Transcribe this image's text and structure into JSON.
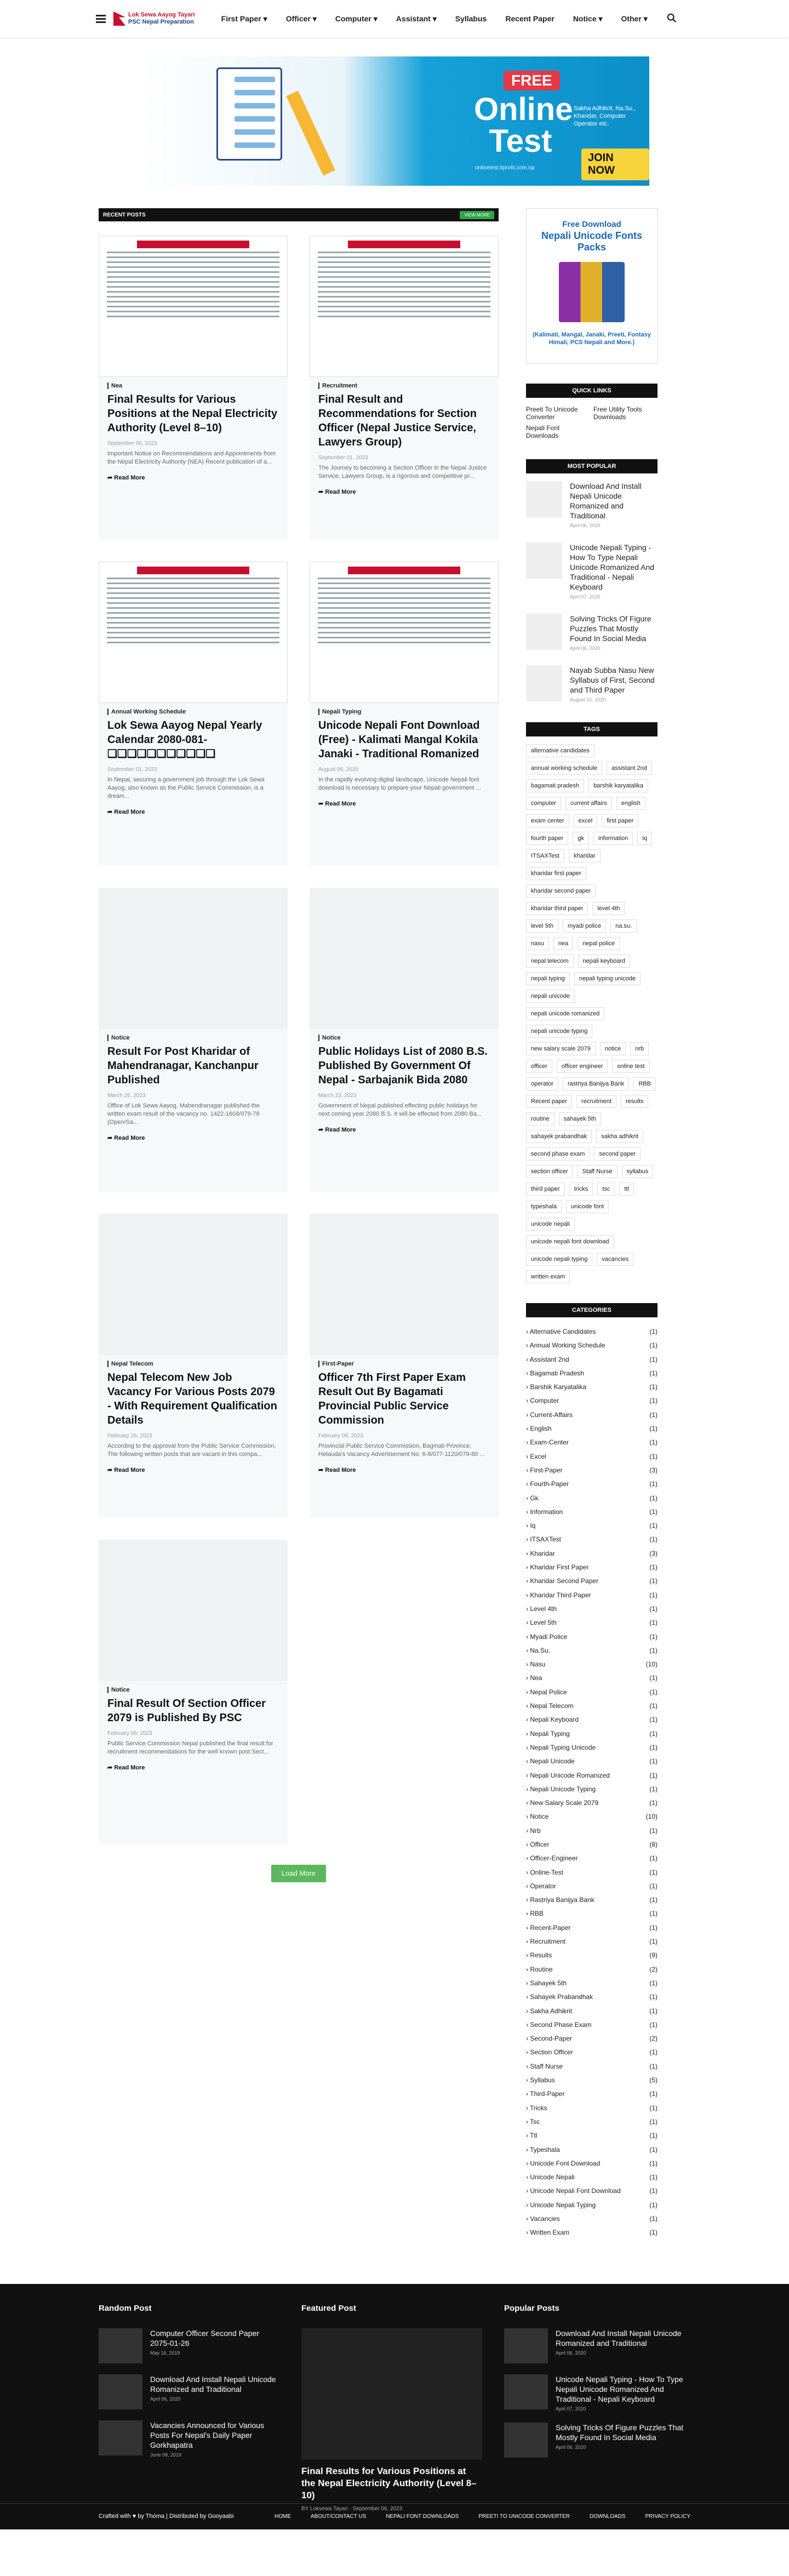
{
  "nav": {
    "logo_line1": "Lok Sewa Aayog Tayari",
    "logo_line2": "PSC Nepal Preparation",
    "menu": [
      "First Paper",
      "Officer",
      "Computer",
      "Assistant",
      "Syllabus",
      "Recent Paper",
      "Notice",
      "Other"
    ]
  },
  "banner": {
    "free": "FREE",
    "online": "Online",
    "test": "Test",
    "sub": "Sakha Adhikrit, Na.Su., Kharidar, Computer Operator etc.",
    "join": "JOIN NOW",
    "url": "onlinetest.itprofit.com.np"
  },
  "recent": {
    "title": "RECENT POSTS",
    "button": "VIEW MORE"
  },
  "posts": [
    {
      "cat": "Nea",
      "title": "Final Results for Various Positions at the Nepal Electricity Authority (Level 8–10)",
      "date": "September 06, 2023",
      "desc": "Important Notice on Recommendations and Appointments from the Nepal Electricity Authority (NEA) Recent publication of a...",
      "more": "Read More"
    },
    {
      "cat": "Recruitment",
      "title": "Final Result and Recommendations for Section Officer (Nepal Justice Service, Lawyers Group)",
      "date": "September 01, 2023",
      "desc": "The Journey to becoming a Section Officer in the Nepal Justice Service, Lawyers Group, is a rigorous and competitive pr...",
      "more": "Read More"
    },
    {
      "cat": "Annual Working Schedule",
      "title": "Lok Sewa Aayog Nepal Yearly Calendar 2080-081- ❑❑❑❑❑❑❑❑❑❑❑",
      "date": "September 01, 2023",
      "desc": "In Nepal, securing a government job through the Lok Sewa Aayog, also known as the Public Service Commission, is a dream...",
      "more": "Read More"
    },
    {
      "cat": "Nepali Typing",
      "title": "Unicode Nepali Font Download (Free) - Kalimati Mangal Kokila Janaki - Traditional Romanized",
      "date": "August 06, 2020",
      "desc": "In the rapidly evolving digital landscape, Unicode Nepali font download is necessary to prepare your Nepali government ...",
      "more": "Read More"
    },
    {
      "cat": "Notice",
      "title": "Result For Post Kharidar of Mahendranagar, Kanchanpur Published",
      "date": "March 26, 2023",
      "desc": "Office of Lok Sewa Aayog, Mahendranagar published the written exam result of the vacancy no. 1422-1603/079-78 (Open/Sa...",
      "more": "Read More"
    },
    {
      "cat": "Notice",
      "title": "Public Holidays List of 2080 B.S. Published By Government Of Nepal - Sarbajanik Bida 2080",
      "date": "March 23, 2023",
      "desc": "Government of Nepal published effecting public holidays for next coming year 2080 B.S. It will be effected from 2080 Ba...",
      "more": "Read More"
    },
    {
      "cat": "Nepal Telecom",
      "title": "Nepal Telecom New Job Vacancy For Various Posts 2079 - With Requirement Qualification Details",
      "date": "February 26, 2023",
      "desc": "According to the approval from the Public Service Commission, The following written posts that are vacant in this compa...",
      "more": "Read More"
    },
    {
      "cat": "First-Paper",
      "title": "Officer 7th First Paper Exam Result Out By Bagamati Provincial Public Service Commission",
      "date": "February 08, 2023",
      "desc": "Provincial Public Service Commission, Bagmati Province, Hetauda's Vacancy Advertisement No. 6-8/077-1120/079-80 ...",
      "more": "Read More"
    },
    {
      "cat": "Notice",
      "title": "Final Result Of Section Officer 2079 is Published By PSC",
      "date": "February 06, 2023",
      "desc": "Public Service Commission Nepal published the final result for recruitment recommendations for the well known post Sect...",
      "more": "Read More"
    }
  ],
  "loadmore": "Load More",
  "ad": {
    "h1": "Free Download",
    "h2": "Nepali Unicode Fonts Packs",
    "fonts": "(Kalimati, Mangal, Janaki, Preeti, Fontasy Himali, PCS Nepali and More.)"
  },
  "quicklinks": {
    "title": "QUICK LINKS",
    "items": [
      "Preeti To Unicode Converter",
      "Free Utility Tools Downloads",
      "Nepali Font Downloads"
    ]
  },
  "popular": {
    "title": "MOST POPULAR",
    "items": [
      {
        "t": "Download And Install Nepali Unicode Romanized and Traditional",
        "d": "April 06, 2020"
      },
      {
        "t": "Unicode Nepali Typing - How To Type Nepali Unicode Romanized And Traditional - Nepali Keyboard",
        "d": "April 07, 2020"
      },
      {
        "t": "Solving Tricks Of Figure Puzzles That Mostly Found In Social Media",
        "d": "April 06, 2020"
      },
      {
        "t": "Nayab Subba Nasu New Syllabus of First, Second and Third Paper",
        "d": "August 01, 2020"
      }
    ]
  },
  "tags": {
    "title": "TAGS",
    "items": [
      "alternative candidates",
      "annual working schedule",
      "assistant 2nd",
      "bagamati pradesh",
      "barshik karyatalika",
      "computer",
      "current affairs",
      "english",
      "exam center",
      "excel",
      "first paper",
      "fourth paper",
      "gk",
      "information",
      "iq",
      "ITSAXTest",
      "kharidar",
      "kharidar first paper",
      "kharidar second paper",
      "kharidar third paper",
      "level 4th",
      "level 5th",
      "myadi police",
      "na.su.",
      "nasu",
      "nea",
      "nepal police",
      "nepal telecom",
      "nepali keyboard",
      "nepali typing",
      "nepali typing unicode",
      "nepali unicode",
      "nepali unicode romanized",
      "nepali unicode typing",
      "new salary scale 2079",
      "notice",
      "nrb",
      "officer",
      "officer engineer",
      "online test",
      "operator",
      "rastriya Banijya Bank",
      "RBB",
      "Recent paper",
      "recruitment",
      "results",
      "routine",
      "sahayek 5th",
      "sahayek prabandhak",
      "sakha adhikrit",
      "second phase exam",
      "second paper",
      "section officer",
      "Staff Nurse",
      "syllabus",
      "third paper",
      "tricks",
      "tsc",
      "ttl",
      "typeshala",
      "unicode font",
      "unicode nepali",
      "unicode nepali font download",
      "unicode nepali typing",
      "vacancies",
      "written exam"
    ]
  },
  "categories": {
    "title": "CATEGORIES",
    "items": [
      [
        "Alternative Candidates",
        "(1)"
      ],
      [
        "Annual Working Schedule",
        "(1)"
      ],
      [
        "Assistant 2nd",
        "(1)"
      ],
      [
        "Bagamati Pradesh",
        "(1)"
      ],
      [
        "Barshik Karyatalika",
        "(1)"
      ],
      [
        "Computer",
        "(1)"
      ],
      [
        "Current-Affairs",
        "(1)"
      ],
      [
        "English",
        "(1)"
      ],
      [
        "Exam-Center",
        "(1)"
      ],
      [
        "Excel",
        "(1)"
      ],
      [
        "First-Paper",
        "(3)"
      ],
      [
        "Fourth-Paper",
        "(1)"
      ],
      [
        "Gk",
        "(1)"
      ],
      [
        "Information",
        "(1)"
      ],
      [
        "Iq",
        "(1)"
      ],
      [
        "ITSAXTest",
        "(1)"
      ],
      [
        "Kharidar",
        "(3)"
      ],
      [
        "Kharidar First Paper",
        "(1)"
      ],
      [
        "Kharidar Second Paper",
        "(1)"
      ],
      [
        "Kharidar Third Paper",
        "(1)"
      ],
      [
        "Level 4th",
        "(1)"
      ],
      [
        "Level 5th",
        "(1)"
      ],
      [
        "Myadi Police",
        "(1)"
      ],
      [
        "Na.Su.",
        "(1)"
      ],
      [
        "Nasu",
        "(10)"
      ],
      [
        "Nea",
        "(1)"
      ],
      [
        "Nepal Police",
        "(1)"
      ],
      [
        "Nepal Telecom",
        "(1)"
      ],
      [
        "Nepali Keyboard",
        "(1)"
      ],
      [
        "Nepali Typing",
        "(1)"
      ],
      [
        "Nepali Typing Unicode",
        "(1)"
      ],
      [
        "Nepali Unicode",
        "(1)"
      ],
      [
        "Nepali Unicode Romanized",
        "(1)"
      ],
      [
        "Nepali Unicode Typing",
        "(1)"
      ],
      [
        "New Salary Scale 2079",
        "(1)"
      ],
      [
        "Notice",
        "(10)"
      ],
      [
        "Nrb",
        "(1)"
      ],
      [
        "Officer",
        "(8)"
      ],
      [
        "Officer-Engineer",
        "(1)"
      ],
      [
        "Online-Test",
        "(1)"
      ],
      [
        "Operator",
        "(1)"
      ],
      [
        "Rastriya Banijya Bank",
        "(1)"
      ],
      [
        "RBB",
        "(1)"
      ],
      [
        "Recent-Paper",
        "(1)"
      ],
      [
        "Recruitment",
        "(1)"
      ],
      [
        "Results",
        "(9)"
      ],
      [
        "Routine",
        "(2)"
      ],
      [
        "Sahayek 5th",
        "(1)"
      ],
      [
        "Sahayek Prabandhak",
        "(1)"
      ],
      [
        "Sakha Adhikrit",
        "(1)"
      ],
      [
        "Second Phase Exam",
        "(1)"
      ],
      [
        "Second-Paper",
        "(2)"
      ],
      [
        "Section Officer",
        "(1)"
      ],
      [
        "Staff Nurse",
        "(1)"
      ],
      [
        "Syllabus",
        "(5)"
      ],
      [
        "Third-Paper",
        "(1)"
      ],
      [
        "Tricks",
        "(1)"
      ],
      [
        "Tsc",
        "(1)"
      ],
      [
        "Ttl",
        "(1)"
      ],
      [
        "Typeshala",
        "(1)"
      ],
      [
        "Unicode Font Download",
        "(1)"
      ],
      [
        "Unicode Nepali",
        "(1)"
      ],
      [
        "Unicode Nepali Font Download",
        "(1)"
      ],
      [
        "Unicode Nepali Typing",
        "(1)"
      ],
      [
        "Vacancies",
        "(1)"
      ],
      [
        "Written Exam",
        "(1)"
      ]
    ]
  },
  "footer": {
    "random": "Random Post",
    "featured": "Featured Post",
    "popular": "Popular Posts",
    "random_items": [
      {
        "t": "Computer Officer Second Paper 2075-01-26",
        "d": "May 16, 2019"
      },
      {
        "t": "Download And Install Nepali Unicode Romanized and Traditional",
        "d": "April 06, 2020"
      },
      {
        "t": "Vacancies Announced for Various Posts For Nepal's Daily Paper Gorkhapatra",
        "d": "June 08, 2019"
      }
    ],
    "feat_title": "Final Results for Various Positions at the Nepal Electricity Authority (Level 8–10)",
    "feat_by": "BY Loksewa Tayari",
    "feat_date": "September 06, 2023",
    "pop_items": [
      {
        "t": "Download And Install Nepali Unicode Romanized and Traditional",
        "d": "April 06, 2020"
      },
      {
        "t": "Unicode Nepali Typing - How To Type Nepali Unicode Romanized And Traditional - Nepali Keyboard",
        "d": "April 07, 2020"
      },
      {
        "t": "Solving Tricks Of Figure Puzzles That Mostly Found In Social Media",
        "d": "April 06, 2020"
      }
    ],
    "credit": "Crafted with ♥ by Thoma | Distributed by Gooyaabi",
    "links": [
      "HOME",
      "ABOUT/CONTACT US",
      "NEPALI FONT DOWNLOADS",
      "PREETI TO UNICODE CONVERTER",
      "DOWNLOADS",
      "PRIVACY POLICY"
    ]
  }
}
